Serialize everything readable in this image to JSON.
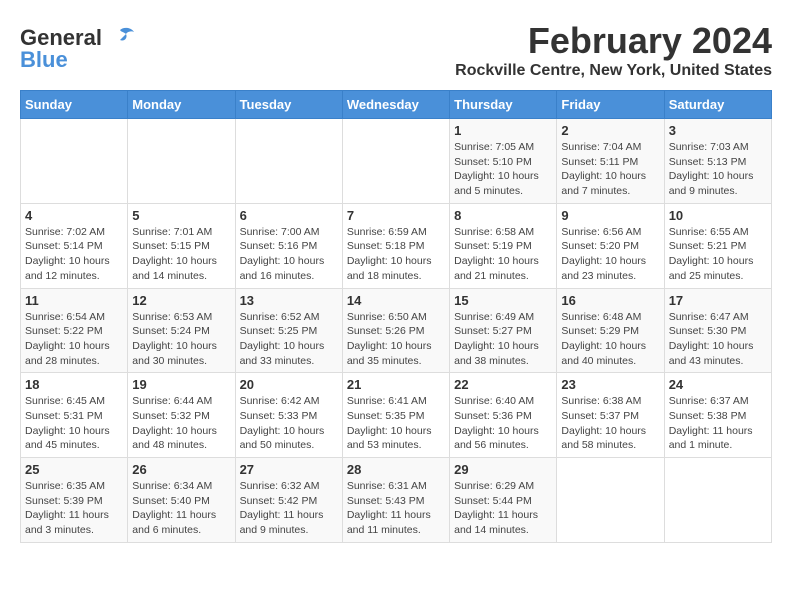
{
  "header": {
    "logo_general": "General",
    "logo_blue": "Blue",
    "month_year": "February 2024",
    "location": "Rockville Centre, New York, United States"
  },
  "days_of_week": [
    "Sunday",
    "Monday",
    "Tuesday",
    "Wednesday",
    "Thursday",
    "Friday",
    "Saturday"
  ],
  "weeks": [
    [
      {
        "day": "",
        "info": ""
      },
      {
        "day": "",
        "info": ""
      },
      {
        "day": "",
        "info": ""
      },
      {
        "day": "",
        "info": ""
      },
      {
        "day": "1",
        "info": "Sunrise: 7:05 AM\nSunset: 5:10 PM\nDaylight: 10 hours\nand 5 minutes."
      },
      {
        "day": "2",
        "info": "Sunrise: 7:04 AM\nSunset: 5:11 PM\nDaylight: 10 hours\nand 7 minutes."
      },
      {
        "day": "3",
        "info": "Sunrise: 7:03 AM\nSunset: 5:13 PM\nDaylight: 10 hours\nand 9 minutes."
      }
    ],
    [
      {
        "day": "4",
        "info": "Sunrise: 7:02 AM\nSunset: 5:14 PM\nDaylight: 10 hours\nand 12 minutes."
      },
      {
        "day": "5",
        "info": "Sunrise: 7:01 AM\nSunset: 5:15 PM\nDaylight: 10 hours\nand 14 minutes."
      },
      {
        "day": "6",
        "info": "Sunrise: 7:00 AM\nSunset: 5:16 PM\nDaylight: 10 hours\nand 16 minutes."
      },
      {
        "day": "7",
        "info": "Sunrise: 6:59 AM\nSunset: 5:18 PM\nDaylight: 10 hours\nand 18 minutes."
      },
      {
        "day": "8",
        "info": "Sunrise: 6:58 AM\nSunset: 5:19 PM\nDaylight: 10 hours\nand 21 minutes."
      },
      {
        "day": "9",
        "info": "Sunrise: 6:56 AM\nSunset: 5:20 PM\nDaylight: 10 hours\nand 23 minutes."
      },
      {
        "day": "10",
        "info": "Sunrise: 6:55 AM\nSunset: 5:21 PM\nDaylight: 10 hours\nand 25 minutes."
      }
    ],
    [
      {
        "day": "11",
        "info": "Sunrise: 6:54 AM\nSunset: 5:22 PM\nDaylight: 10 hours\nand 28 minutes."
      },
      {
        "day": "12",
        "info": "Sunrise: 6:53 AM\nSunset: 5:24 PM\nDaylight: 10 hours\nand 30 minutes."
      },
      {
        "day": "13",
        "info": "Sunrise: 6:52 AM\nSunset: 5:25 PM\nDaylight: 10 hours\nand 33 minutes."
      },
      {
        "day": "14",
        "info": "Sunrise: 6:50 AM\nSunset: 5:26 PM\nDaylight: 10 hours\nand 35 minutes."
      },
      {
        "day": "15",
        "info": "Sunrise: 6:49 AM\nSunset: 5:27 PM\nDaylight: 10 hours\nand 38 minutes."
      },
      {
        "day": "16",
        "info": "Sunrise: 6:48 AM\nSunset: 5:29 PM\nDaylight: 10 hours\nand 40 minutes."
      },
      {
        "day": "17",
        "info": "Sunrise: 6:47 AM\nSunset: 5:30 PM\nDaylight: 10 hours\nand 43 minutes."
      }
    ],
    [
      {
        "day": "18",
        "info": "Sunrise: 6:45 AM\nSunset: 5:31 PM\nDaylight: 10 hours\nand 45 minutes."
      },
      {
        "day": "19",
        "info": "Sunrise: 6:44 AM\nSunset: 5:32 PM\nDaylight: 10 hours\nand 48 minutes."
      },
      {
        "day": "20",
        "info": "Sunrise: 6:42 AM\nSunset: 5:33 PM\nDaylight: 10 hours\nand 50 minutes."
      },
      {
        "day": "21",
        "info": "Sunrise: 6:41 AM\nSunset: 5:35 PM\nDaylight: 10 hours\nand 53 minutes."
      },
      {
        "day": "22",
        "info": "Sunrise: 6:40 AM\nSunset: 5:36 PM\nDaylight: 10 hours\nand 56 minutes."
      },
      {
        "day": "23",
        "info": "Sunrise: 6:38 AM\nSunset: 5:37 PM\nDaylight: 10 hours\nand 58 minutes."
      },
      {
        "day": "24",
        "info": "Sunrise: 6:37 AM\nSunset: 5:38 PM\nDaylight: 11 hours\nand 1 minute."
      }
    ],
    [
      {
        "day": "25",
        "info": "Sunrise: 6:35 AM\nSunset: 5:39 PM\nDaylight: 11 hours\nand 3 minutes."
      },
      {
        "day": "26",
        "info": "Sunrise: 6:34 AM\nSunset: 5:40 PM\nDaylight: 11 hours\nand 6 minutes."
      },
      {
        "day": "27",
        "info": "Sunrise: 6:32 AM\nSunset: 5:42 PM\nDaylight: 11 hours\nand 9 minutes."
      },
      {
        "day": "28",
        "info": "Sunrise: 6:31 AM\nSunset: 5:43 PM\nDaylight: 11 hours\nand 11 minutes."
      },
      {
        "day": "29",
        "info": "Sunrise: 6:29 AM\nSunset: 5:44 PM\nDaylight: 11 hours\nand 14 minutes."
      },
      {
        "day": "",
        "info": ""
      },
      {
        "day": "",
        "info": ""
      }
    ]
  ]
}
